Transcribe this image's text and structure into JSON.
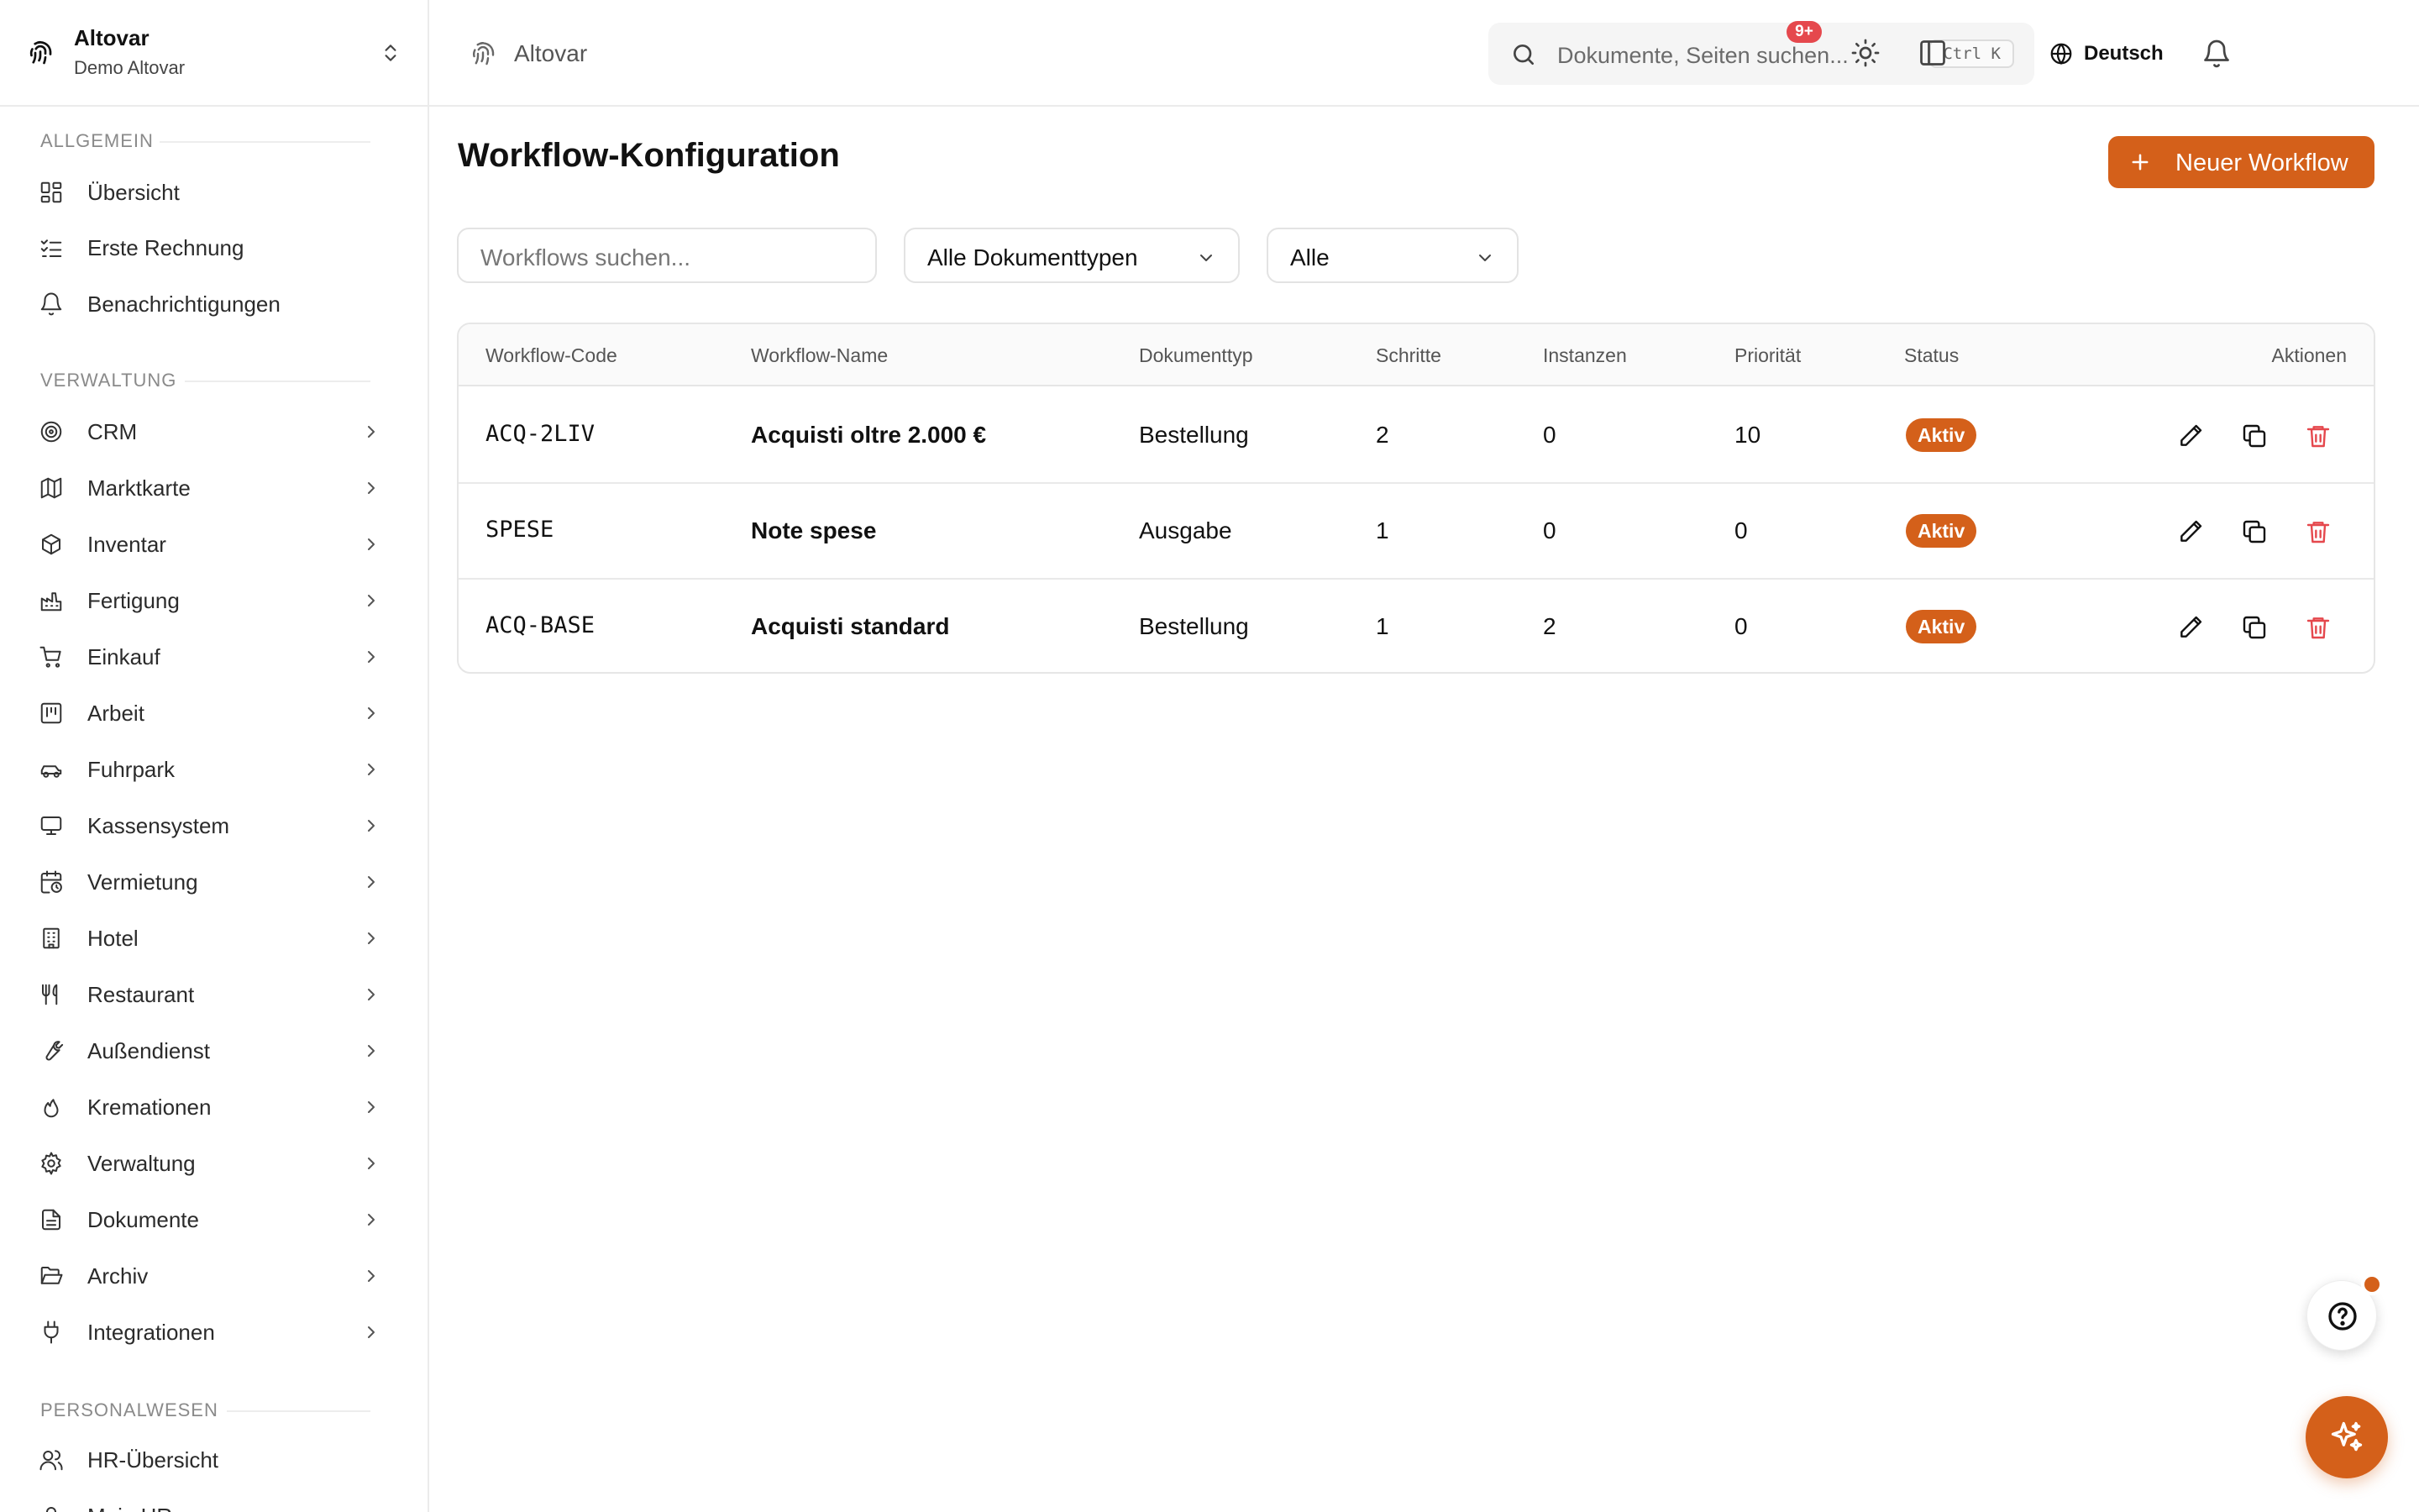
{
  "org": {
    "name": "Altovar",
    "subtitle": "Demo Altovar"
  },
  "sidebar": {
    "sections": [
      {
        "label": "ALLGEMEIN"
      },
      {
        "label": "VERWALTUNG"
      },
      {
        "label": "PERSONALWESEN"
      }
    ],
    "general": [
      {
        "label": "Übersicht",
        "icon": "dashboard-icon"
      },
      {
        "label": "Erste Rechnung",
        "icon": "checklist-icon"
      },
      {
        "label": "Benachrichtigungen",
        "icon": "bell-icon"
      }
    ],
    "admin": [
      {
        "label": "CRM",
        "icon": "target-icon"
      },
      {
        "label": "Marktkarte",
        "icon": "map-icon"
      },
      {
        "label": "Inventar",
        "icon": "package-icon"
      },
      {
        "label": "Fertigung",
        "icon": "factory-icon"
      },
      {
        "label": "Einkauf",
        "icon": "cart-icon"
      },
      {
        "label": "Arbeit",
        "icon": "kanban-icon"
      },
      {
        "label": "Fuhrpark",
        "icon": "car-icon"
      },
      {
        "label": "Kassensystem",
        "icon": "monitor-icon"
      },
      {
        "label": "Vermietung",
        "icon": "calendar-clock-icon"
      },
      {
        "label": "Hotel",
        "icon": "building-icon"
      },
      {
        "label": "Restaurant",
        "icon": "utensils-icon"
      },
      {
        "label": "Außendienst",
        "icon": "wrench-icon"
      },
      {
        "label": "Kremationen",
        "icon": "flame-icon"
      },
      {
        "label": "Verwaltung",
        "icon": "gear-icon"
      },
      {
        "label": "Dokumente",
        "icon": "document-icon"
      },
      {
        "label": "Archiv",
        "icon": "folder-open-icon"
      },
      {
        "label": "Integrationen",
        "icon": "plug-icon"
      }
    ],
    "hr": [
      {
        "label": "HR-Übersicht",
        "icon": "users-icon"
      },
      {
        "label": "Mein HR",
        "icon": "user-icon"
      }
    ]
  },
  "header": {
    "breadcrumb": "Altovar",
    "search": {
      "placeholder": "Dokumente, Seiten suchen...",
      "shortcut": "Ctrl K"
    },
    "language": "Deutsch",
    "notifications_badge": "9+"
  },
  "main": {
    "title": "Workflow-Konfiguration",
    "new_button": "Neuer Workflow",
    "filters": {
      "search_placeholder": "Workflows suchen...",
      "doc_type": "Alle Dokumenttypen",
      "status": "Alle"
    },
    "table": {
      "headers": {
        "code": "Workflow-Code",
        "name": "Workflow-Name",
        "doctype": "Dokumenttyp",
        "steps": "Schritte",
        "instances": "Instanzen",
        "priority": "Priorität",
        "status": "Status",
        "actions": "Aktionen"
      },
      "rows": [
        {
          "code": "ACQ-2LIV",
          "name": "Acquisti oltre 2.000 €",
          "doctype": "Bestellung",
          "steps": "2",
          "instances": "0",
          "priority": "10",
          "status": "Aktiv"
        },
        {
          "code": "SPESE",
          "name": "Note spese",
          "doctype": "Ausgabe",
          "steps": "1",
          "instances": "0",
          "priority": "0",
          "status": "Aktiv"
        },
        {
          "code": "ACQ-BASE",
          "name": "Acquisti standard",
          "doctype": "Bestellung",
          "steps": "1",
          "instances": "2",
          "priority": "0",
          "status": "Aktiv"
        }
      ]
    }
  },
  "colors": {
    "accent": "#d4601a",
    "danger": "#e5484d",
    "border": "#e6e6e6"
  }
}
